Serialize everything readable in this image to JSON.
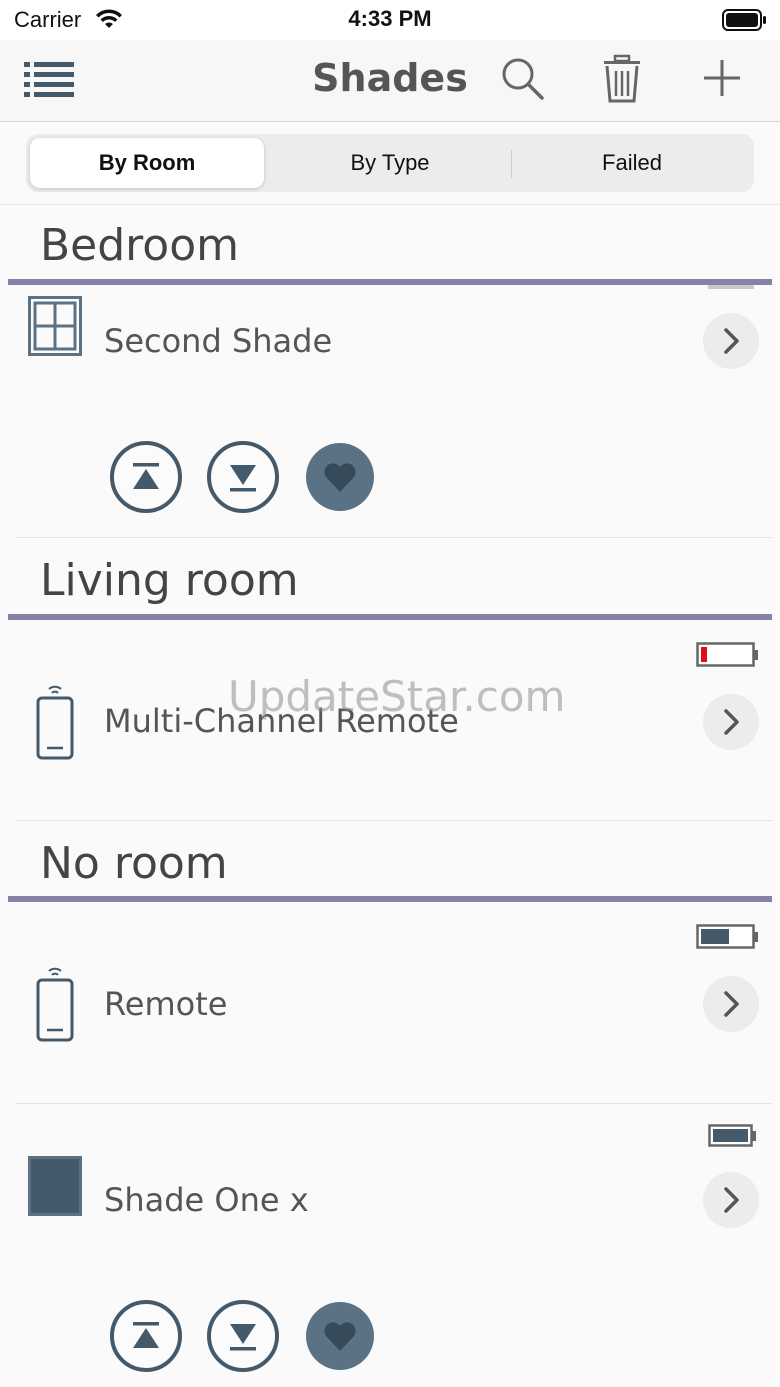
{
  "status_bar": {
    "carrier": "Carrier",
    "time": "4:33 PM"
  },
  "nav": {
    "title": "Shades"
  },
  "segments": {
    "by_room": "By Room",
    "by_type": "By Type",
    "failed": "Failed",
    "selected": "By Room"
  },
  "rooms": [
    {
      "name": "Bedroom",
      "items": [
        {
          "label": "Second Shade",
          "icon": "window-shade-icon",
          "controls": true
        }
      ]
    },
    {
      "name": "Living room",
      "items": [
        {
          "label": "Multi-Channel Remote",
          "icon": "remote-icon",
          "battery": "low"
        }
      ]
    },
    {
      "name": "No room",
      "items": [
        {
          "label": "Remote",
          "icon": "remote-icon",
          "battery": "half"
        },
        {
          "label": "Shade One x",
          "icon": "solid-shade-icon",
          "battery": "full",
          "controls": true
        }
      ]
    }
  ],
  "watermark": "UpdateStar.com",
  "colors": {
    "accent": "#44596a",
    "section_line": "#8482a6",
    "battery_low": "#e01010"
  }
}
